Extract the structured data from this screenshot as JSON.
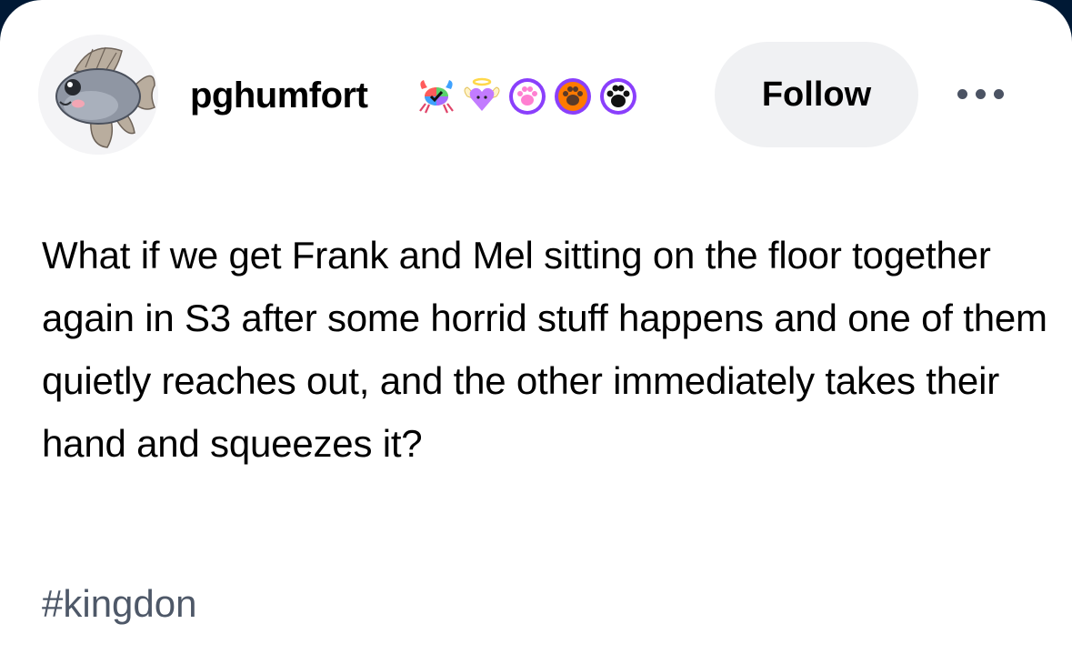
{
  "post": {
    "author": {
      "username": "pghumfort",
      "avatar_icon": "fish-avatar-icon",
      "badges": [
        {
          "icon": "rainbow-crab-badge-icon",
          "colors": [
            "#ff5b5b",
            "#ffd23f",
            "#5ad16d",
            "#3fa2ff",
            "#a66bff"
          ]
        },
        {
          "icon": "angel-heart-badge-icon",
          "colors": [
            "#c27bff",
            "#ffd84a"
          ]
        },
        {
          "icon": "pink-paw-badge-icon",
          "colors": [
            "#8a3ffc",
            "#ff7fd1"
          ]
        },
        {
          "icon": "orange-paw-badge-icon",
          "colors": [
            "#ff7a00",
            "#5a3a28"
          ]
        },
        {
          "icon": "black-paw-badge-icon",
          "colors": [
            "#8a3ffc",
            "#111111"
          ]
        }
      ]
    },
    "actions": {
      "follow_label": "Follow",
      "more_icon": "more-options-icon"
    },
    "body_text": "What if we get Frank and Mel sitting on the floor together again in S3 after some horrid stuff happens and one of them quietly reaches out, and the other immediately takes their hand and squeezes it?",
    "tags": [
      "#kingdon"
    ]
  },
  "theme": {
    "page_background": "#001935",
    "card_background": "#ffffff",
    "follow_button_background": "#f0f1f3",
    "tag_color": "#4e5868"
  }
}
